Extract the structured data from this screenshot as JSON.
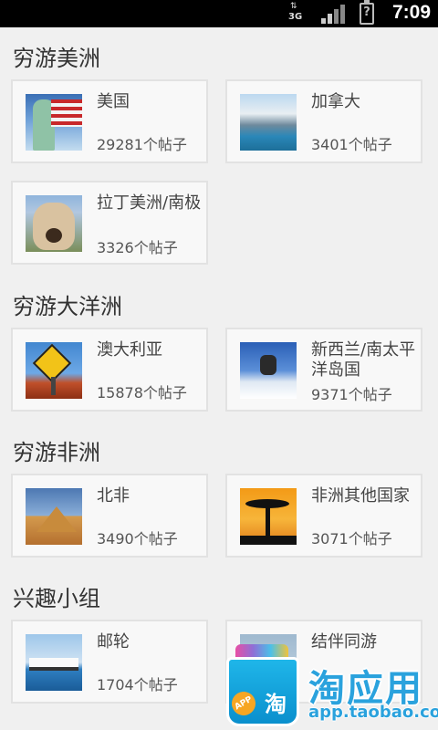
{
  "status_bar": {
    "network": "3G",
    "time": "7:09",
    "battery_symbol": "?"
  },
  "sections": [
    {
      "title": "穷游美洲",
      "cards": [
        {
          "name": "美国",
          "count": "29281个帖子",
          "thumb": "statue-of-liberty"
        },
        {
          "name": "加拿大",
          "count": "3401个帖子",
          "thumb": "mountain-lake"
        },
        {
          "name": "拉丁美洲/南极",
          "count": "3326个帖子",
          "thumb": "llama"
        }
      ]
    },
    {
      "title": "穷游大洋洲",
      "cards": [
        {
          "name": "澳大利亚",
          "count": "15878个帖子",
          "thumb": "kangaroo-sign"
        },
        {
          "name": "新西兰/南太平洋岛国",
          "count": "9371个帖子",
          "thumb": "snowboarder"
        }
      ]
    },
    {
      "title": "穷游非洲",
      "cards": [
        {
          "name": "北非",
          "count": "3490个帖子",
          "thumb": "pyramids"
        },
        {
          "name": "非洲其他国家",
          "count": "3071个帖子",
          "thumb": "savanna-sunset"
        }
      ]
    },
    {
      "title": "兴趣小组",
      "cards": [
        {
          "name": "邮轮",
          "count": "1704个帖子",
          "thumb": "cruise-ship"
        },
        {
          "name": "结伴同游",
          "count": "",
          "thumb": "group"
        }
      ]
    }
  ],
  "watermark": {
    "title": "淘应用",
    "url": "app.taobao.com",
    "badge": "APP",
    "bag_char": "淘"
  }
}
